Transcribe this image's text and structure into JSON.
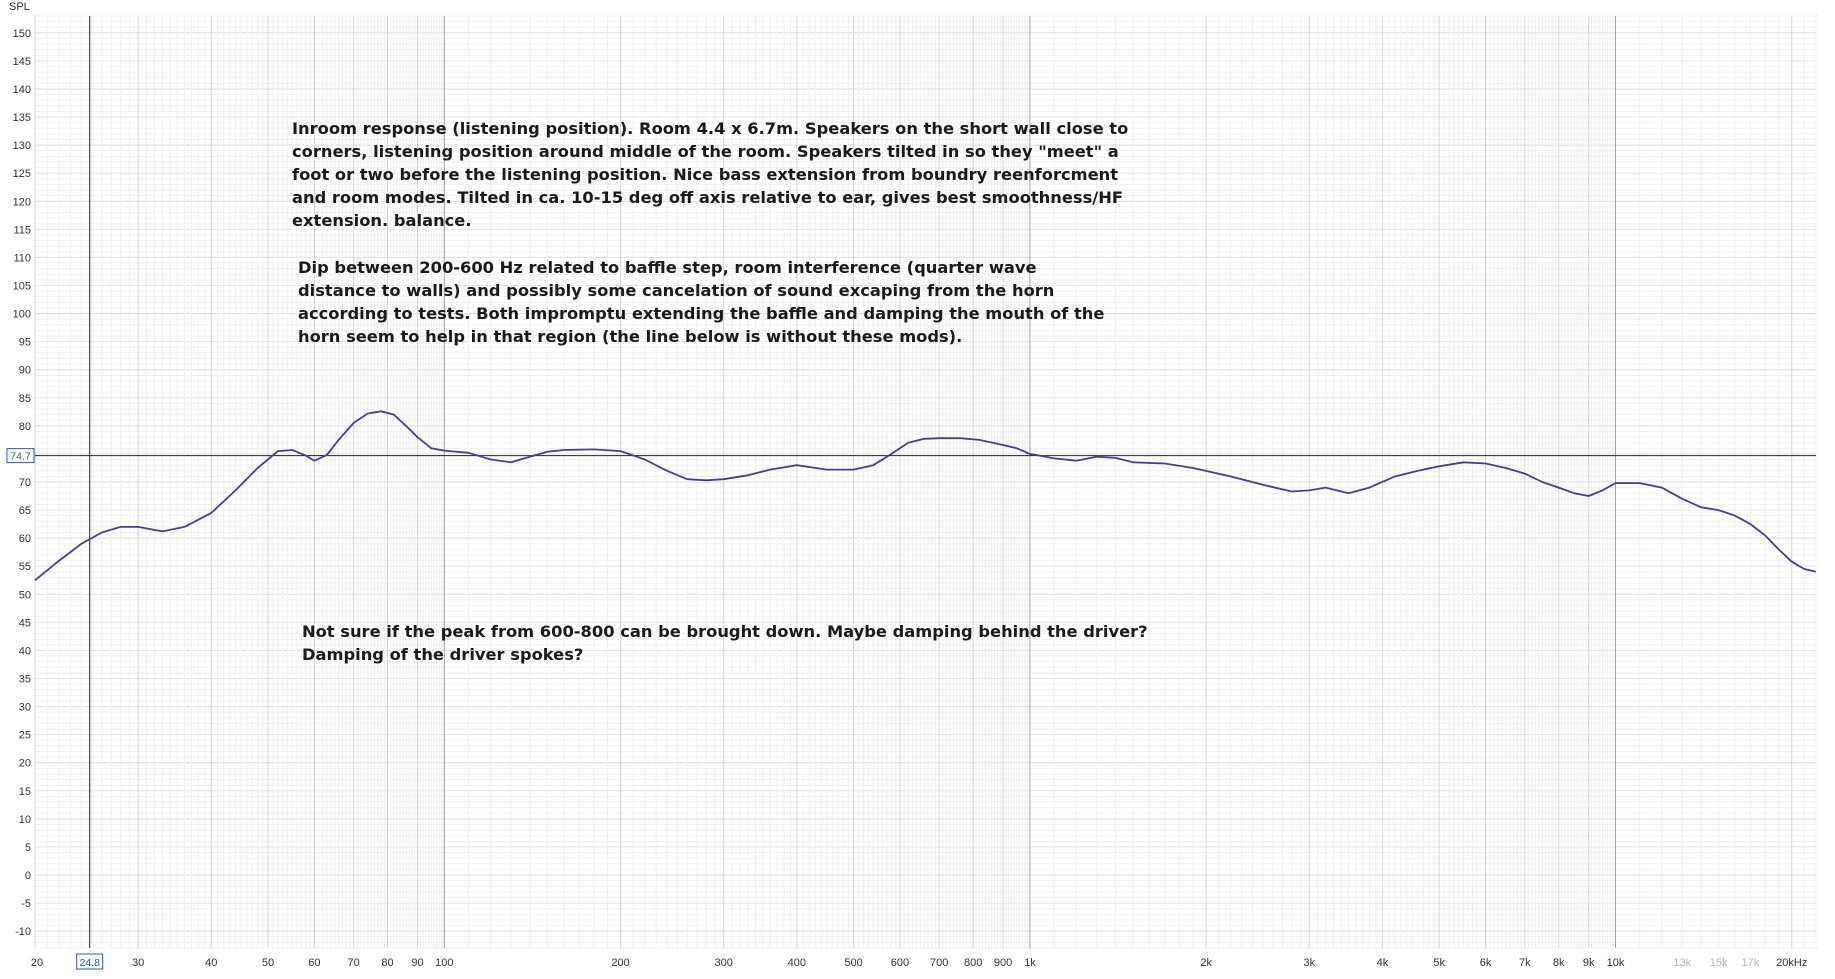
{
  "chart_data": {
    "type": "line",
    "xscale": "log",
    "xlim": [
      20,
      22000
    ],
    "ylim": [
      -13,
      153
    ],
    "ylabel": "SPL",
    "y_ticks": [
      150,
      145,
      140,
      135,
      130,
      125,
      120,
      115,
      110,
      105,
      100,
      95,
      90,
      85,
      80,
      75,
      70,
      65,
      60,
      55,
      50,
      45,
      40,
      35,
      30,
      25,
      20,
      15,
      10,
      5,
      0,
      -5,
      -10
    ],
    "y_tick_labels": [
      "150",
      "145",
      "140",
      "135",
      "130",
      "125",
      "120",
      "115",
      "110",
      "105",
      "100",
      "95",
      "90",
      "85",
      "80",
      "75",
      "70",
      "65",
      "60",
      "55",
      "50",
      "45",
      "40",
      "35",
      "30",
      "25",
      "20",
      "15",
      "10",
      "5",
      "0",
      "-5",
      "-10"
    ],
    "x_ticks": [
      {
        "value": 20,
        "label": "20"
      },
      {
        "value": 30,
        "label": "30"
      },
      {
        "value": 40,
        "label": "40"
      },
      {
        "value": 50,
        "label": "50"
      },
      {
        "value": 60,
        "label": "60"
      },
      {
        "value": 70,
        "label": "70"
      },
      {
        "value": 80,
        "label": "80"
      },
      {
        "value": 90,
        "label": "90"
      },
      {
        "value": 100,
        "label": "100"
      },
      {
        "value": 200,
        "label": "200"
      },
      {
        "value": 300,
        "label": "300"
      },
      {
        "value": 400,
        "label": "400"
      },
      {
        "value": 500,
        "label": "500"
      },
      {
        "value": 600,
        "label": "600"
      },
      {
        "value": 700,
        "label": "700"
      },
      {
        "value": 800,
        "label": "800"
      },
      {
        "value": 900,
        "label": "900"
      },
      {
        "value": 1000,
        "label": "1k"
      },
      {
        "value": 2000,
        "label": "2k"
      },
      {
        "value": 3000,
        "label": "3k"
      },
      {
        "value": 4000,
        "label": "4k"
      },
      {
        "value": 5000,
        "label": "5k"
      },
      {
        "value": 6000,
        "label": "6k"
      },
      {
        "value": 7000,
        "label": "7k"
      },
      {
        "value": 8000,
        "label": "8k"
      },
      {
        "value": 9000,
        "label": "9k"
      },
      {
        "value": 10000,
        "label": "10k"
      },
      {
        "value": 13000,
        "label": "13k",
        "muted": true
      },
      {
        "value": 15000,
        "label": "15k",
        "muted": true
      },
      {
        "value": 17000,
        "label": "17k",
        "muted": true
      },
      {
        "value": 20000,
        "label": "20kHz"
      }
    ],
    "cursor": {
      "x": 24.8,
      "x_label": "24.8",
      "y": 74.7,
      "y_label": "74.7"
    },
    "grid": true,
    "series": [
      {
        "color": "#40409a",
        "x": [
          20,
          22,
          24,
          26,
          28,
          30,
          33,
          36,
          40,
          44,
          48,
          52,
          55,
          58,
          60,
          63,
          66,
          70,
          74,
          78,
          82,
          86,
          90,
          95,
          100,
          110,
          120,
          130,
          140,
          150,
          160,
          180,
          200,
          220,
          240,
          260,
          280,
          300,
          330,
          360,
          400,
          450,
          500,
          540,
          580,
          620,
          660,
          700,
          760,
          820,
          880,
          950,
          1000,
          1100,
          1200,
          1300,
          1400,
          1500,
          1700,
          1900,
          2200,
          2500,
          2800,
          3000,
          3200,
          3500,
          3800,
          4200,
          4600,
          5000,
          5500,
          6000,
          6500,
          7000,
          7500,
          8000,
          8500,
          9000,
          9500,
          10000,
          11000,
          12000,
          13000,
          14000,
          15000,
          16000,
          17000,
          18000,
          19000,
          20000,
          21000,
          22000
        ],
        "y": [
          52.5,
          56.0,
          59.0,
          61.0,
          62.0,
          62.0,
          61.2,
          62.0,
          64.5,
          68.5,
          72.5,
          75.5,
          75.7,
          74.7,
          73.8,
          74.8,
          77.5,
          80.5,
          82.2,
          82.6,
          82.0,
          80.0,
          78.0,
          76.0,
          75.6,
          75.2,
          74.0,
          73.5,
          74.5,
          75.4,
          75.7,
          75.8,
          75.5,
          74.0,
          72.0,
          70.5,
          70.3,
          70.5,
          71.2,
          72.2,
          73.0,
          72.2,
          72.2,
          73.0,
          75.0,
          77.0,
          77.7,
          77.8,
          77.8,
          77.5,
          76.8,
          76.0,
          75.0,
          74.2,
          73.8,
          74.5,
          74.3,
          73.5,
          73.3,
          72.5,
          71.0,
          69.5,
          68.3,
          68.5,
          69.0,
          68.0,
          69.0,
          71.0,
          72.0,
          72.8,
          73.5,
          73.3,
          72.5,
          71.5,
          70.0,
          69.0,
          68.0,
          67.5,
          68.5,
          69.8,
          69.8,
          69.0,
          67.0,
          65.5,
          65.0,
          64.0,
          62.5,
          60.5,
          58.0,
          55.8,
          54.5,
          54.0
        ]
      }
    ]
  },
  "annotations": [
    {
      "lines": [
        "Inroom response (listening position). Room 4.4 x 6.7m. Speakers on the short wall close to",
        "corners, listening position around middle of the room. Speakers tilted in so they \"meet\" a",
        "foot or two before the listening position. Nice bass extension from boundry reenforcment",
        "and room modes. Tilted in ca. 10-15 deg off axis relative to ear, gives best smoothness/HF",
        "extension. balance."
      ]
    },
    {
      "lines": [
        "Dip between 200-600 Hz related to baffle step, room interference (quarter wave",
        "distance to walls) and possibly some cancelation of sound excaping from the horn",
        "according to tests. Both impromptu extending the baffle and damping the mouth of the",
        "horn seem to help in that region (the line below is without these mods)."
      ]
    },
    {
      "lines": [
        "Not sure if the peak from 600-800 can be brought down. Maybe damping behind the driver?",
        "Damping of the driver spokes?"
      ]
    }
  ]
}
